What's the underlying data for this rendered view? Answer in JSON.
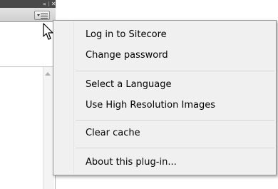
{
  "panel": {
    "collapse_glyph": "«",
    "close_glyph": "✕"
  },
  "menu_items": [
    "Log in to Sitecore",
    "Change password",
    "Select a Language",
    "Use High Resolution Images",
    "Clear cache",
    "About this plug-in..."
  ],
  "colors": {
    "panel_topbar": "#4a4a4a",
    "menu_background": "#f0f0f0",
    "menu_border": "#979797",
    "menu_text": "#000000"
  }
}
